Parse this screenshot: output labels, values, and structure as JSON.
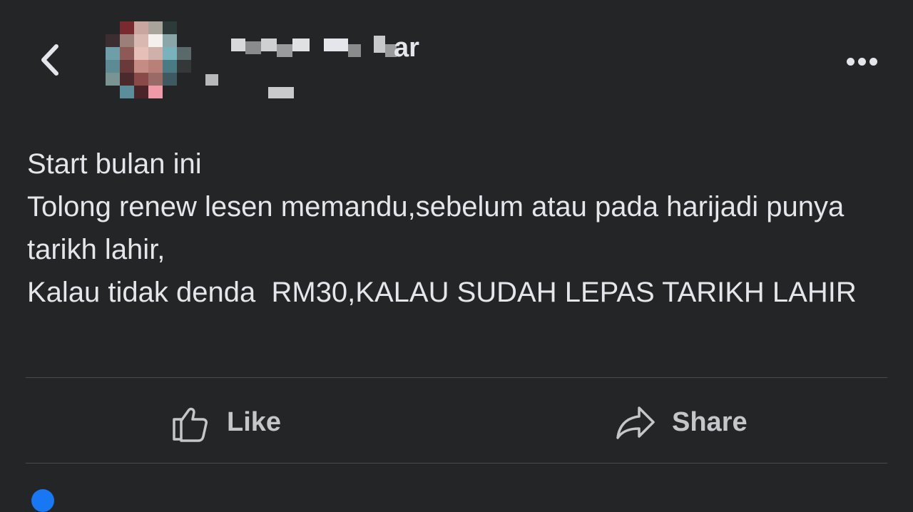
{
  "header": {
    "back_icon": "chevron-left-icon",
    "author_name_visible": "ar",
    "more_icon": "ellipsis-icon"
  },
  "post": {
    "text": "Start bulan ini\nTolong renew lesen memandu,sebelum atau pada harijadi punya tarikh lahir,\nKalau tidak denda  RM30,KALAU SUDAH LEPAS TARIKH LAHIR"
  },
  "actions": {
    "like_label": "Like",
    "like_icon": "thumbs-up-icon",
    "share_label": "Share",
    "share_icon": "share-arrow-icon"
  },
  "colors": {
    "background": "#242526",
    "text": "#e4e6eb",
    "divider": "#4a4b4d"
  }
}
